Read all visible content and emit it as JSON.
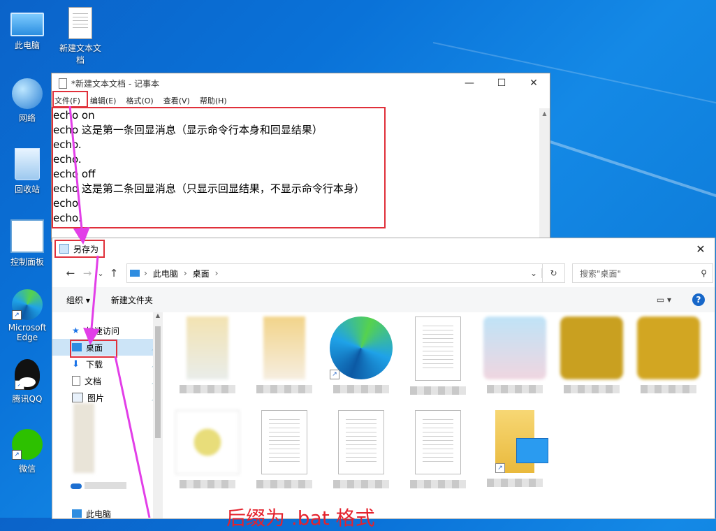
{
  "desktop": {
    "icons": [
      {
        "label": "此电脑",
        "icon": "computer-icon"
      },
      {
        "label": "新建文本文档",
        "icon": "text-file-icon"
      },
      {
        "label": "网络",
        "icon": "network-icon"
      },
      {
        "label": "回收站",
        "icon": "recycle-bin-icon"
      },
      {
        "label": "控制面板",
        "icon": "control-panel-icon"
      },
      {
        "label": "Microsoft Edge",
        "icon": "edge-icon"
      },
      {
        "label": "腾讯QQ",
        "icon": "qq-icon"
      },
      {
        "label": "微信",
        "icon": "wechat-icon"
      }
    ]
  },
  "notepad": {
    "title": "*新建文本文档 - 记事本",
    "controls": {
      "minimize": "—",
      "maximize": "☐",
      "close": "✕"
    },
    "menu": [
      "文件(F)",
      "编辑(E)",
      "格式(O)",
      "查看(V)",
      "帮助(H)"
    ],
    "lines": [
      "echo on",
      "echo 这是第一条回显消息（显示命令行本身和回显结果）",
      "echo.",
      "echo.",
      "echo off",
      "echo 这是第二条回显消息（只显示回显结果，不显示命令行本身）",
      "echo.",
      "echo."
    ]
  },
  "save_dialog": {
    "title": "另存为",
    "close": "✕",
    "nav": {
      "back": "←",
      "forward": "→",
      "recent": "⌄",
      "up": "↑"
    },
    "address": {
      "parts": [
        "此电脑",
        "桌面"
      ],
      "sep": "›",
      "dropdown": "⌄",
      "refresh": "↻"
    },
    "search_placeholder": "搜索\"桌面\"",
    "toolbar": {
      "organize": "组织 ▾",
      "new_folder": "新建文件夹",
      "view": "▭ ▾",
      "help": "?"
    },
    "nav_items": [
      {
        "label": "快速访问",
        "pinned": false
      },
      {
        "label": "桌面",
        "pinned": true
      },
      {
        "label": "下载",
        "pinned": true
      },
      {
        "label": "文档",
        "pinned": true
      },
      {
        "label": "图片",
        "pinned": true
      }
    ],
    "nav_bottom": "此电脑",
    "scroll_up": "▲"
  },
  "annotation": "后缀为 .bat 格式",
  "colors": {
    "highlight": "#e0303a",
    "arrow": "#e23ee8",
    "annotation": "#e4222d"
  }
}
